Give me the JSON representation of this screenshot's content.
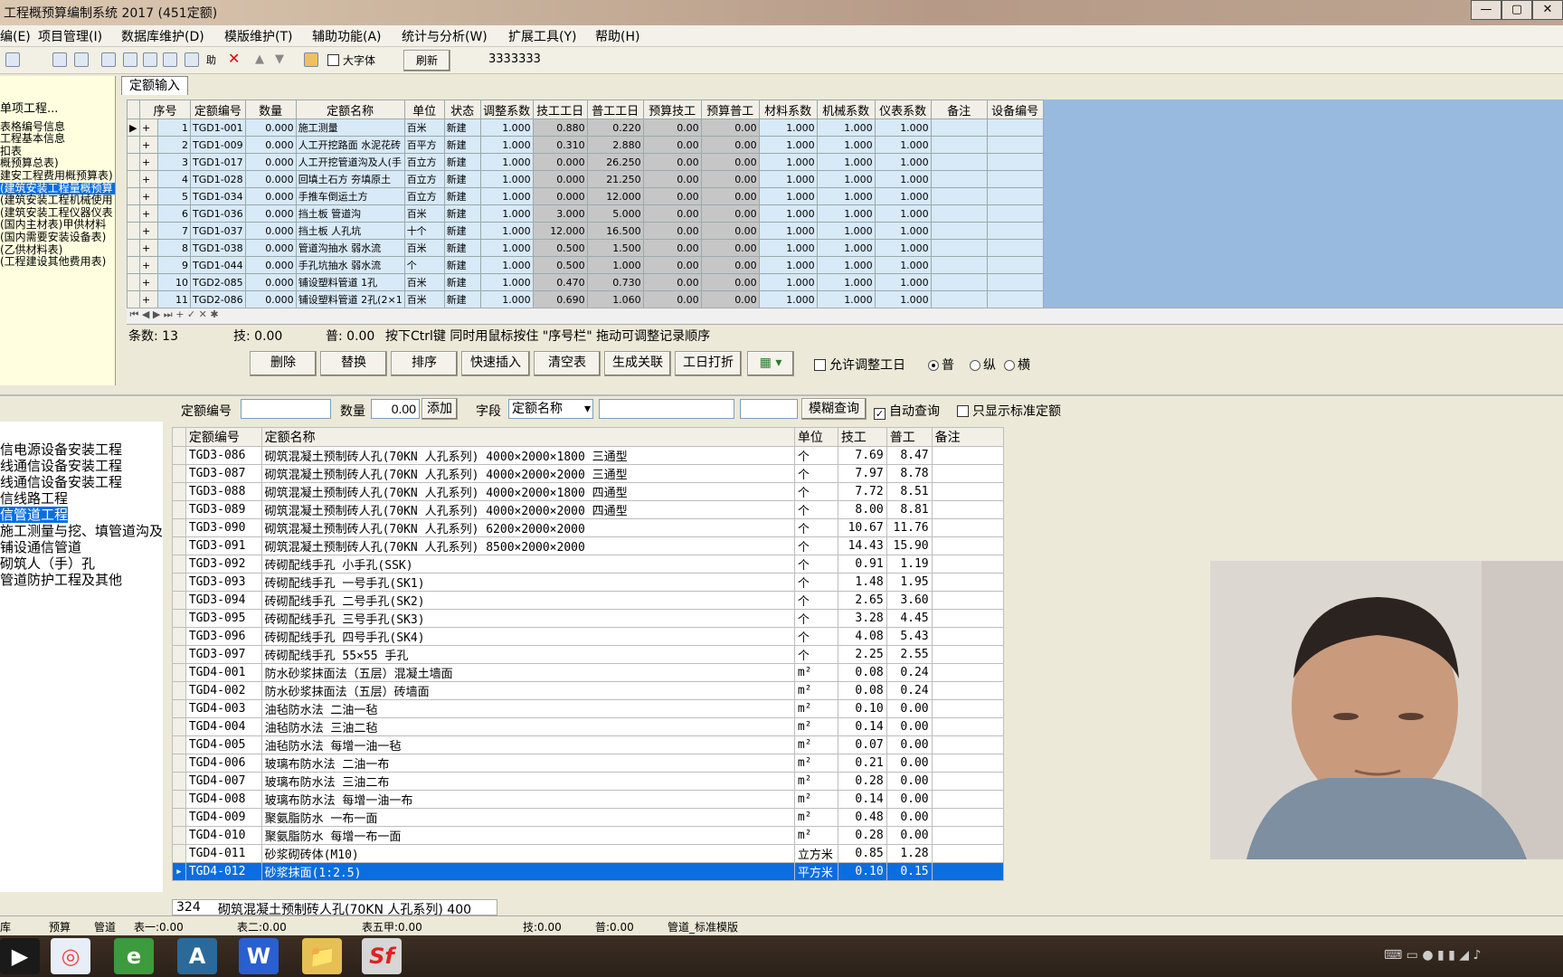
{
  "title": "工程概预算编制系统 2017 (451定额)",
  "window_buttons": [
    "—",
    "▢",
    "✕"
  ],
  "menu": [
    "编(E)",
    "项目管理(I)",
    "数据库维护(D)",
    "模版维护(T)",
    "辅助功能(A)",
    "统计与分析(W)",
    "扩展工具(Y)",
    "帮助(H)"
  ],
  "toolbar": {
    "big_font": "大字体",
    "refresh": "刷新",
    "code": "3333333"
  },
  "left_tree": [
    "单项工程...",
    "",
    "表格编号信息",
    "工程基本信息",
    "扣表",
    "概预算总表)",
    "建安工程费用概预算表)",
    "(建筑安装工程量概预算",
    "(建筑安装工程机械使用",
    "(建筑安装工程仪器仪表",
    "(国内主材表)甲供材料",
    "(国内需要安装设备表)",
    "(乙供材料表)",
    "(工程建设其他费用表)"
  ],
  "tab": "定额输入",
  "upper": {
    "headers": [
      "序号",
      "定额编号",
      "数量",
      "定额名称",
      "单位",
      "状态",
      "调整系数",
      "技工工日",
      "普工工日",
      "预算技工",
      "预算普工",
      "材料系数",
      "机械系数",
      "仪表系数",
      "备注",
      "设备编号"
    ],
    "rows": [
      [
        "1",
        "TGD1-001",
        "0.000",
        "施工测量",
        "百米",
        "新建",
        "1.000",
        "0.880",
        "0.220",
        "0.00",
        "0.00",
        "1.000",
        "1.000",
        "1.000"
      ],
      [
        "2",
        "TGD1-009",
        "0.000",
        "人工开挖路面 水泥花砖",
        "百平方",
        "新建",
        "1.000",
        "0.310",
        "2.880",
        "0.00",
        "0.00",
        "1.000",
        "1.000",
        "1.000"
      ],
      [
        "3",
        "TGD1-017",
        "0.000",
        "人工开挖管道沟及人(手",
        "百立方",
        "新建",
        "1.000",
        "0.000",
        "26.250",
        "0.00",
        "0.00",
        "1.000",
        "1.000",
        "1.000"
      ],
      [
        "4",
        "TGD1-028",
        "0.000",
        "回填土石方 夯填原土",
        "百立方",
        "新建",
        "1.000",
        "0.000",
        "21.250",
        "0.00",
        "0.00",
        "1.000",
        "1.000",
        "1.000"
      ],
      [
        "5",
        "TGD1-034",
        "0.000",
        "手推车倒运土方",
        "百立方",
        "新建",
        "1.000",
        "0.000",
        "12.000",
        "0.00",
        "0.00",
        "1.000",
        "1.000",
        "1.000"
      ],
      [
        "6",
        "TGD1-036",
        "0.000",
        "挡土板 管道沟",
        "百米",
        "新建",
        "1.000",
        "3.000",
        "5.000",
        "0.00",
        "0.00",
        "1.000",
        "1.000",
        "1.000"
      ],
      [
        "7",
        "TGD1-037",
        "0.000",
        "挡土板 人孔坑",
        "十个",
        "新建",
        "1.000",
        "12.000",
        "16.500",
        "0.00",
        "0.00",
        "1.000",
        "1.000",
        "1.000"
      ],
      [
        "8",
        "TGD1-038",
        "0.000",
        "管道沟抽水 弱水流",
        "百米",
        "新建",
        "1.000",
        "0.500",
        "1.500",
        "0.00",
        "0.00",
        "1.000",
        "1.000",
        "1.000"
      ],
      [
        "9",
        "TGD1-044",
        "0.000",
        "手孔坑抽水 弱水流",
        "个",
        "新建",
        "1.000",
        "0.500",
        "1.000",
        "0.00",
        "0.00",
        "1.000",
        "1.000",
        "1.000"
      ],
      [
        "10",
        "TGD2-085",
        "0.000",
        "铺设塑料管道 1孔",
        "百米",
        "新建",
        "1.000",
        "0.470",
        "0.730",
        "0.00",
        "0.00",
        "1.000",
        "1.000",
        "1.000"
      ],
      [
        "11",
        "TGD2-086",
        "0.000",
        "铺设塑料管道 2孔(2×1",
        "百米",
        "新建",
        "1.000",
        "0.690",
        "1.060",
        "0.00",
        "0.00",
        "1.000",
        "1.000",
        "1.000"
      ]
    ]
  },
  "upper_status": {
    "count": "条数: 13",
    "ji": "技: 0.00",
    "pu": "普: 0.00",
    "hint": "按下Ctrl键 同时用鼠标按住 \"序号栏\" 拖动可调整记录顺序"
  },
  "actions": [
    "删除",
    "替换",
    "排序",
    "快速插入",
    "清空表",
    "生成关联",
    "工日打折"
  ],
  "options": {
    "allow": "允许调整工日",
    "pu": "普",
    "zong": "纵",
    "heng": "横"
  },
  "search": {
    "code_label": "定额编号",
    "qty_label": "数量",
    "qty_value": "0.00",
    "add": "添加",
    "field_label": "字段",
    "field_value": "定额名称",
    "fuzzy": "模糊查询",
    "auto": "自动查询",
    "std": "只显示标准定额"
  },
  "lower_left": [
    "信电源设备安装工程",
    "线通信设备安装工程",
    "线通信设备安装工程",
    "信线路工程",
    "信管道工程",
    "施工测量与挖、填管道沟及",
    "铺设通信管道",
    "砌筑人（手）孔",
    "管道防护工程及其他"
  ],
  "lower": {
    "headers": [
      "定额编号",
      "定额名称",
      "单位",
      "技工",
      "普工",
      "备注"
    ],
    "rows": [
      [
        "TGD3-086",
        "砌筑混凝土预制砖人孔(70KN 人孔系列) 4000×2000×1800 三通型",
        "个",
        "7.69",
        "8.47"
      ],
      [
        "TGD3-087",
        "砌筑混凝土预制砖人孔(70KN 人孔系列) 4000×2000×2000 三通型",
        "个",
        "7.97",
        "8.78"
      ],
      [
        "TGD3-088",
        "砌筑混凝土预制砖人孔(70KN 人孔系列) 4000×2000×1800 四通型",
        "个",
        "7.72",
        "8.51"
      ],
      [
        "TGD3-089",
        "砌筑混凝土预制砖人孔(70KN 人孔系列) 4000×2000×2000 四通型",
        "个",
        "8.00",
        "8.81"
      ],
      [
        "TGD3-090",
        "砌筑混凝土预制砖人孔(70KN 人孔系列) 6200×2000×2000",
        "个",
        "10.67",
        "11.76"
      ],
      [
        "TGD3-091",
        "砌筑混凝土预制砖人孔(70KN 人孔系列) 8500×2000×2000",
        "个",
        "14.43",
        "15.90"
      ],
      [
        "TGD3-092",
        "砖砌配线手孔 小手孔(SSK)",
        "个",
        "0.91",
        "1.19"
      ],
      [
        "TGD3-093",
        "砖砌配线手孔 一号手孔(SK1)",
        "个",
        "1.48",
        "1.95"
      ],
      [
        "TGD3-094",
        "砖砌配线手孔 二号手孔(SK2)",
        "个",
        "2.65",
        "3.60"
      ],
      [
        "TGD3-095",
        "砖砌配线手孔 三号手孔(SK3)",
        "个",
        "3.28",
        "4.45"
      ],
      [
        "TGD3-096",
        "砖砌配线手孔 四号手孔(SK4)",
        "个",
        "4.08",
        "5.43"
      ],
      [
        "TGD3-097",
        "砖砌配线手孔 55×55 手孔",
        "个",
        "2.25",
        "2.55"
      ],
      [
        "TGD4-001",
        "防水砂浆抹面法（五层）混凝土墙面",
        "m²",
        "0.08",
        "0.24"
      ],
      [
        "TGD4-002",
        "防水砂浆抹面法（五层）砖墙面",
        "m²",
        "0.08",
        "0.24"
      ],
      [
        "TGD4-003",
        "油毡防水法 二油一毡",
        "m²",
        "0.10",
        "0.00"
      ],
      [
        "TGD4-004",
        "油毡防水法 三油二毡",
        "m²",
        "0.14",
        "0.00"
      ],
      [
        "TGD4-005",
        "油毡防水法 每增一油一毡",
        "m²",
        "0.07",
        "0.00"
      ],
      [
        "TGD4-006",
        "玻璃布防水法 二油一布",
        "m²",
        "0.21",
        "0.00"
      ],
      [
        "TGD4-007",
        "玻璃布防水法 三油二布",
        "m²",
        "0.28",
        "0.00"
      ],
      [
        "TGD4-008",
        "玻璃布防水法 每增一油一布",
        "m²",
        "0.14",
        "0.00"
      ],
      [
        "TGD4-009",
        "聚氨脂防水 一布一面",
        "m²",
        "0.48",
        "0.00"
      ],
      [
        "TGD4-010",
        "聚氨脂防水 每增一布一面",
        "m²",
        "0.28",
        "0.00"
      ],
      [
        "TGD4-011",
        "砂浆砌砖体(M10)",
        "立方米",
        "0.85",
        "1.28"
      ],
      [
        "TGD4-012",
        "砂浆抹面(1:2.5)",
        "平方米",
        "0.10",
        "0.15"
      ]
    ]
  },
  "bottom_strip": {
    "num": "324",
    "text": "砌筑混凝土预制砖人孔(70KN 人孔系列) 400"
  },
  "statusbar": [
    "库",
    "预算",
    "管道",
    "表一:0.00",
    "表二:0.00",
    "表五甲:0.00",
    "技:0.00",
    "普:0.00",
    "管道_标准模版"
  ],
  "taskbar": [
    "▶",
    "◎",
    "e",
    "A",
    "W",
    "📁",
    "Sf"
  ]
}
